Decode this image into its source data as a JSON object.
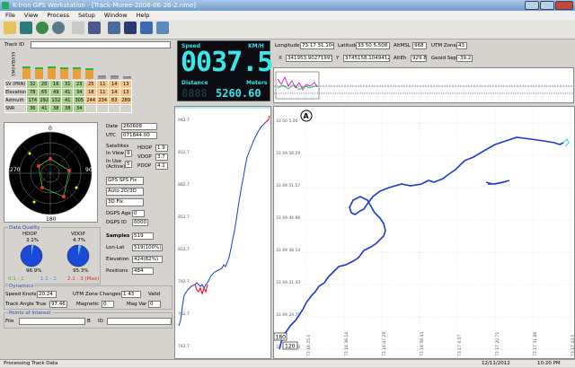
{
  "window": {
    "title": "K-tron GPS Workstation - [Track-Muree-2008-06-26-2.nme]"
  },
  "menu": [
    "File",
    "View",
    "Process",
    "Setup",
    "Window",
    "Help"
  ],
  "toolbar": {
    "icons": [
      "open-folder-icon",
      "satellite-icon",
      "globe-icon",
      "globe-alt-icon",
      "print-icon",
      "save-icon",
      "gps-receiver-icon",
      "device-icon",
      "export-icon",
      "grid-icon"
    ]
  },
  "track_id": {
    "label": "Track ID",
    "value": ""
  },
  "sv": {
    "levels_axis": [
      "55",
      "50",
      "45",
      "40",
      "35"
    ],
    "rows": [
      {
        "label": "SV (PRN)",
        "values": [
          "32",
          "20",
          "16",
          "31",
          "23",
          "25",
          "11",
          "14",
          "13"
        ]
      },
      {
        "label": "Elevation",
        "values": [
          "78",
          "65",
          "49",
          "41",
          "34",
          "18",
          "11",
          "14",
          "13"
        ]
      },
      {
        "label": "Azimuth",
        "values": [
          "174",
          "292",
          "132",
          "41",
          "305",
          "244",
          "234",
          "83",
          "289"
        ]
      },
      {
        "label": "SNR",
        "values": [
          "36",
          "41",
          "38",
          "38",
          "34",
          "",
          "",
          "",
          ""
        ]
      }
    ],
    "signal_levels": [
      0.55,
      0.5,
      0.55,
      0.5,
      0.5,
      0.45,
      0.15,
      0.15,
      0.1
    ]
  },
  "skyplot": {
    "labels": [
      "0",
      "90",
      "180",
      "270"
    ]
  },
  "status": {
    "date_label": "Date",
    "date": "260608",
    "utc_label": "UTC",
    "utc": "071844.00",
    "satellites_label": "Satellites",
    "in_view_label": "In View",
    "in_view": "9",
    "in_use_label": "In Use (Active)",
    "in_use": "5",
    "hdop_label": "HDOP",
    "hdop": "1.9",
    "vdop_label": "VDOP",
    "vdop": "3.7",
    "pdop_label": "PDOP",
    "pdop": "4.1",
    "fix_type": "GPS SPS Fix",
    "mode": "Auto 2D/3D",
    "dim": "3D Fix",
    "dgps_age_label": "DGPS Age",
    "dgps_age": "0",
    "dgps_id_label": "DGPS ID",
    "dgps_id": "0000",
    "samples_label": "Samples",
    "samples": "519",
    "lonlat_label": "Lon-Lat",
    "lonlat": "519(100%)",
    "elevation_label": "Elevation",
    "elevation": "424(82%)",
    "positions_label": "Positions",
    "positions": "484"
  },
  "data_quality": {
    "title": "Data Quality",
    "hdop_title": "HDOP",
    "hdop_top": "3.1%",
    "hdop_bottom": "96.9%",
    "vdop_title": "VDOP",
    "vdop_top": "4.7%",
    "vdop_bottom": "95.3%",
    "legend": [
      "0.1 - 1",
      "1.1 - 2",
      "2.1 - 3 (Max)"
    ],
    "pie_fraction_hdop": 0.969,
    "pie_fraction_vdop": 0.953
  },
  "dynamics": {
    "title": "Dynamics",
    "speed_label": "Speed  Knots",
    "speed": "20.24",
    "utm_changes_label": "UTM Zone Changes",
    "utm_changes": "1  43",
    "valid": "Valid",
    "track_angle_label": "Track Angle  True",
    "track_angle": "97.46",
    "magnetic_label": "Magnetic",
    "magnetic": "0",
    "mag_var_label": "Mag Var",
    "mag_var": "0"
  },
  "poi": {
    "title": "Points of Interest",
    "file_label": "File",
    "b_label": "B",
    "id_label": "ID"
  },
  "speed_display": {
    "speed_label": "Speed",
    "unit": "KM/H",
    "value": "0037.5",
    "distance_label": "Distance",
    "meters_label": "Meters",
    "distance": "5260.60",
    "distance_ghost": "8888"
  },
  "coords": {
    "longitude_label": "Longitude",
    "longitude": "73 17 31.104",
    "latitude_label": "Latitude",
    "latitude": "33 50 5.508",
    "altmsl_label": "AltMSL",
    "altmsl": "968",
    "utm_zone_label": "UTM Zone",
    "utm_zone": "43",
    "x_label": "X",
    "x": "341953.902719937",
    "y_label": "Y",
    "y": "3745158.10494123",
    "alteh_label": "AltEh",
    "alteh": "929.8",
    "geoid_label": "Geoid Sep",
    "geoid": "-39.2"
  },
  "elevation_chart": {
    "y_ticks": [
      "942.7",
      "912.7",
      "882.7",
      "852.7",
      "822.7",
      "792.7",
      "762.7",
      "742.7"
    ]
  },
  "track_map": {
    "north_label": "A",
    "lat_ticks": [
      "33 50 5.00",
      "33 49 58.29",
      "33 49 51.57",
      "33 49 44.86",
      "33 49 38.14",
      "33 49 31.43",
      "33 49 24.71",
      "33 49 18.00"
    ],
    "lon_ticks": [
      "73 16 25.0",
      "73 16 36.14",
      "73 16 47.29",
      "73 16 58.43",
      "73 17 9.57",
      "73 17 20.71",
      "73 17 31.86",
      "73 17 43.0"
    ],
    "zoom_box_1": "180",
    "zoom_box_2": "120"
  },
  "statusbar": {
    "message": "Processing Track Data",
    "date": "12/11/2012",
    "time": "10:20 PM"
  }
}
